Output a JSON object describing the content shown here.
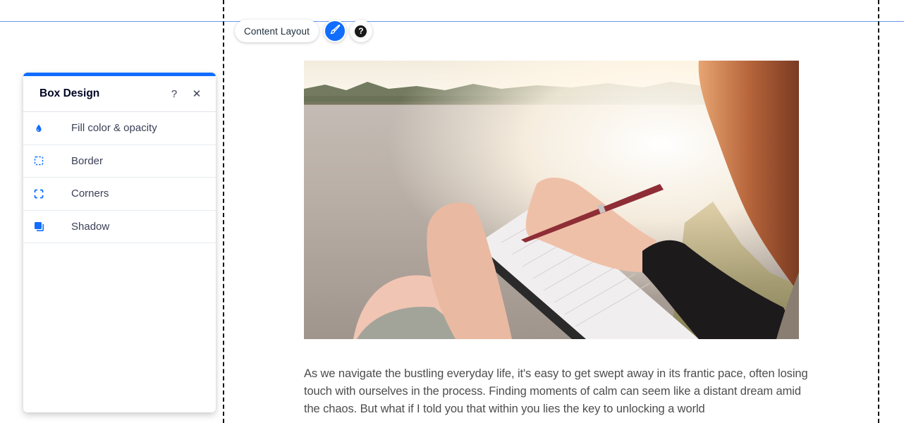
{
  "toolbar": {
    "content_layout_label": "Content Layout",
    "design_button_icon": "paintbrush-icon",
    "help_button_icon": "question-icon",
    "help_glyph": "?"
  },
  "panel": {
    "title": "Box Design",
    "help_glyph": "?",
    "close_glyph": "✕",
    "accent_color": "#116dff",
    "items": [
      {
        "label": "Fill color & opacity",
        "icon": "drop-icon"
      },
      {
        "label": "Border",
        "icon": "border-icon"
      },
      {
        "label": "Corners",
        "icon": "corners-icon"
      },
      {
        "label": "Shadow",
        "icon": "shadow-icon"
      }
    ]
  },
  "content": {
    "image_alt": "Woman writing in a spiral notebook by a lake at sunset",
    "paragraph": "As we navigate the bustling everyday life, it's easy to get swept away in its frantic pace, often losing touch with ourselves in the process. Finding moments of calm can seem like a distant dream amid the chaos. But what if I told you that within you lies the key to unlocking a world"
  }
}
